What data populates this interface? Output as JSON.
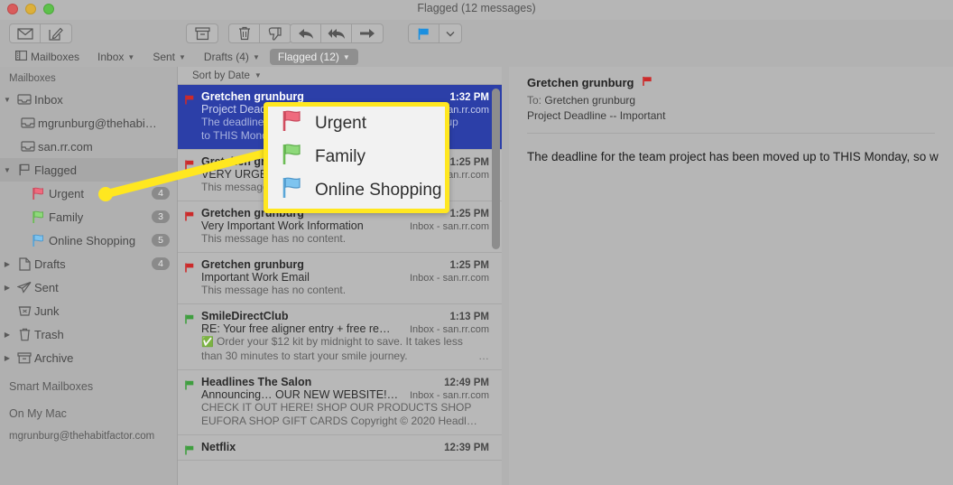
{
  "window": {
    "title": "Flagged (12 messages)",
    "traffic_lights": [
      "close-red",
      "minimize-yellow",
      "zoom-green"
    ]
  },
  "toolbar": {
    "buttons": [
      {
        "name": "get-mail",
        "icon": "envelope-icon"
      },
      {
        "name": "compose",
        "icon": "compose-icon"
      },
      {
        "name": "archive",
        "icon": "archive-box-icon"
      },
      {
        "name": "delete",
        "icon": "trash-icon"
      },
      {
        "name": "junk",
        "icon": "thumbs-down-icon"
      },
      {
        "name": "reply",
        "icon": "reply-arrow-icon"
      },
      {
        "name": "reply-all",
        "icon": "reply-all-arrow-icon"
      },
      {
        "name": "forward",
        "icon": "forward-arrow-icon"
      },
      {
        "name": "flag",
        "icon": "flag-icon"
      },
      {
        "name": "flag-menu",
        "icon": "chevron-down-icon"
      }
    ],
    "flag_active_color": "#1a8fe0"
  },
  "favorites_bar": {
    "items": [
      {
        "label": "Mailboxes",
        "icon": "sidebar-toggle-icon",
        "has_chevron": false,
        "selected": false
      },
      {
        "label": "Inbox",
        "has_chevron": true,
        "selected": false
      },
      {
        "label": "Sent",
        "has_chevron": true,
        "selected": false
      },
      {
        "label": "Drafts (4)",
        "has_chevron": true,
        "selected": false
      },
      {
        "label": "Flagged (12)",
        "has_chevron": true,
        "selected": true
      }
    ]
  },
  "sidebar": {
    "header": "Mailboxes",
    "items": [
      {
        "label": "Inbox",
        "icon": "inbox-tray-icon",
        "twisty": "down",
        "indent": 0,
        "badge": "",
        "highlight": false
      },
      {
        "label": "mgrunburg@thehabi…",
        "icon": "inbox-tray-icon",
        "twisty": "",
        "indent": 1,
        "badge": "",
        "highlight": false
      },
      {
        "label": "san.rr.com",
        "icon": "inbox-tray-icon",
        "twisty": "",
        "indent": 1,
        "badge": "",
        "highlight": false
      },
      {
        "label": "Flagged",
        "icon": "flag-outline-icon",
        "twisty": "down",
        "indent": 0,
        "badge": "",
        "highlight": true
      },
      {
        "label": "Urgent",
        "icon": "flag-red-icon",
        "twisty": "",
        "indent": 1,
        "badge": "4",
        "highlight": false
      },
      {
        "label": "Family",
        "icon": "flag-green-icon",
        "twisty": "",
        "indent": 1,
        "badge": "3",
        "highlight": false
      },
      {
        "label": "Online Shopping",
        "icon": "flag-blue-icon",
        "twisty": "",
        "indent": 1,
        "badge": "5",
        "highlight": false
      },
      {
        "label": "Drafts",
        "icon": "drafts-page-icon",
        "twisty": "right",
        "indent": 0,
        "badge": "4",
        "highlight": false
      },
      {
        "label": "Sent",
        "icon": "paper-plane-icon",
        "twisty": "right",
        "indent": 0,
        "badge": "",
        "highlight": false
      },
      {
        "label": "Junk",
        "icon": "junk-bin-icon",
        "twisty": "",
        "indent": 0,
        "badge": "",
        "highlight": false
      },
      {
        "label": "Trash",
        "icon": "trash-icon",
        "twisty": "right",
        "indent": 0,
        "badge": "",
        "highlight": false
      },
      {
        "label": "Archive",
        "icon": "archive-box-icon",
        "twisty": "right",
        "indent": 0,
        "badge": "",
        "highlight": false
      }
    ],
    "sections": [
      {
        "label": "Smart Mailboxes"
      },
      {
        "label": "On My Mac"
      }
    ],
    "account": "mgrunburg@thehabitfactor.com"
  },
  "message_list": {
    "sort_label": "Sort by Date",
    "messages": [
      {
        "flag_color": "#cc2a2a",
        "from": "Gretchen grunburg",
        "time": "1:32 PM",
        "subject": "Project Deadline -- Important",
        "mailbox": "Inbox - san.rr.com",
        "preview_line1": "The deadline for the team project has been moved up",
        "preview_line2": "to THIS Monday, so we will need to go over…",
        "selected": true,
        "has_check": false
      },
      {
        "flag_color": "#cc2a2a",
        "from": "Gretchen grunburg",
        "time": "1:25 PM",
        "subject": "VERY URGENT WORK STUFF",
        "mailbox": "Inbox - san.rr.com",
        "preview_line1": "This message has no content.",
        "preview_line2": "",
        "selected": false,
        "has_check": false
      },
      {
        "flag_color": "#cc2a2a",
        "from": "Gretchen grunburg",
        "time": "1:25 PM",
        "subject": "Very Important Work Information",
        "mailbox": "Inbox - san.rr.com",
        "preview_line1": "This message has no content.",
        "preview_line2": "",
        "selected": false,
        "has_check": false
      },
      {
        "flag_color": "#cc2a2a",
        "from": "Gretchen grunburg",
        "time": "1:25 PM",
        "subject": "Important Work Email",
        "mailbox": "Inbox - san.rr.com",
        "preview_line1": "This message has no content.",
        "preview_line2": "",
        "selected": false,
        "has_check": false
      },
      {
        "flag_color": "#3f9e3f",
        "from": "SmileDirectClub",
        "time": "1:13 PM",
        "subject": "RE: Your free aligner entry + free re…",
        "mailbox": "Inbox - san.rr.com",
        "preview_line1": "Order your $12 kit by midnight to save. It takes less",
        "preview_line2": "than 30 minutes to start your smile journey.",
        "selected": false,
        "has_check": true,
        "preview_ellipsis": "…"
      },
      {
        "flag_color": "#3f9e3f",
        "from": "Headlines The Salon",
        "time": "12:49 PM",
        "subject": "Announcing… OUR NEW WEBSITE!…",
        "mailbox": "Inbox - san.rr.com",
        "preview_line1": "CHECK IT OUT HERE! SHOP OUR PRODUCTS SHOP",
        "preview_line2": "EUFORA SHOP GIFT CARDS Copyright © 2020 Headl…",
        "selected": false,
        "has_check": false
      },
      {
        "flag_color": "#3f9e3f",
        "from": "Netflix",
        "time": "12:39 PM",
        "subject": "",
        "mailbox": "",
        "preview_line1": "",
        "preview_line2": "",
        "selected": false,
        "has_check": false
      }
    ]
  },
  "reading_pane": {
    "from": "Gretchen grunburg",
    "flag_color": "#cc2a2a",
    "to_label": "To:",
    "to_value": "Gretchen grunburg",
    "subject": "Project Deadline -- Important",
    "body": "The deadline for the team project has been moved up to THIS Monday, so w"
  },
  "callout_popup": {
    "border_color": "#ffe720",
    "items": [
      {
        "label": "Urgent",
        "flag_color": "#ef6b7e",
        "flag_stroke": "#c84a5e"
      },
      {
        "label": "Family",
        "flag_color": "#8ed97a",
        "flag_stroke": "#5fae4d"
      },
      {
        "label": "Online Shopping",
        "flag_color": "#7ec4ef",
        "flag_stroke": "#4f96c8"
      }
    ],
    "pointer_dot_color": "#ffe720"
  }
}
